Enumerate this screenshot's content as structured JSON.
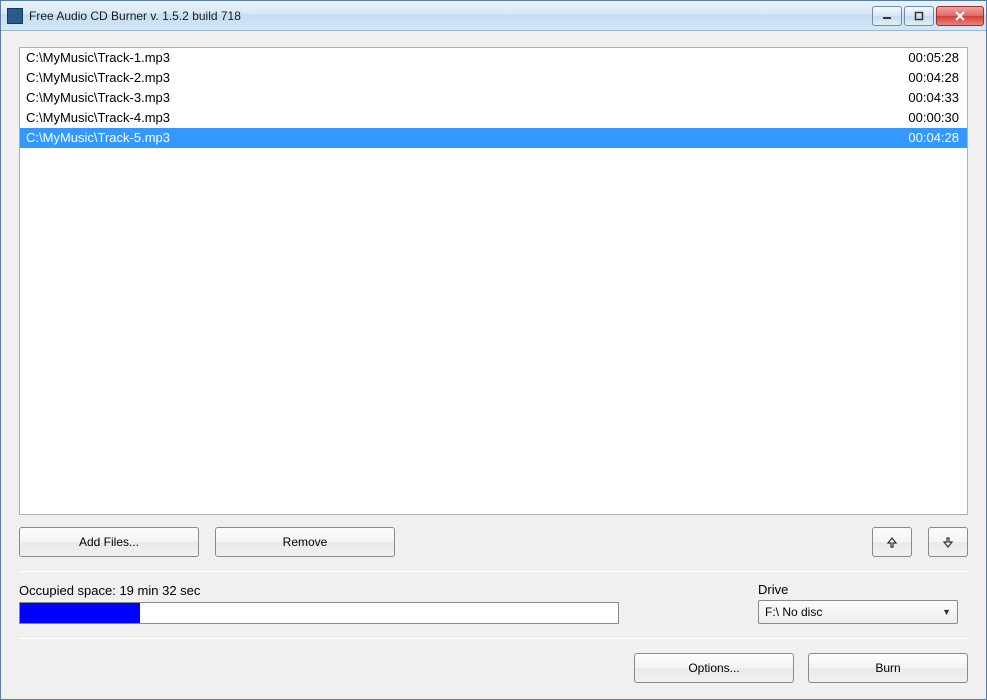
{
  "window": {
    "title": "Free Audio CD Burner  v. 1.5.2 build 718"
  },
  "tracks": [
    {
      "path": "C:\\MyMusic\\Track-1.mp3",
      "duration": "00:05:28",
      "selected": false
    },
    {
      "path": "C:\\MyMusic\\Track-2.mp3",
      "duration": "00:04:28",
      "selected": false
    },
    {
      "path": "C:\\MyMusic\\Track-3.mp3",
      "duration": "00:04:33",
      "selected": false
    },
    {
      "path": "C:\\MyMusic\\Track-4.mp3",
      "duration": "00:00:30",
      "selected": false
    },
    {
      "path": "C:\\MyMusic\\Track-5.mp3",
      "duration": "00:04:28",
      "selected": true
    }
  ],
  "buttons": {
    "add_files": "Add Files...",
    "remove": "Remove",
    "options": "Options...",
    "burn": "Burn"
  },
  "occupied": {
    "label_prefix": "Occupied space:  ",
    "value": "19 min 32 sec",
    "percent": 20
  },
  "drive": {
    "label": "Drive",
    "selected": "F:\\ No disc"
  }
}
